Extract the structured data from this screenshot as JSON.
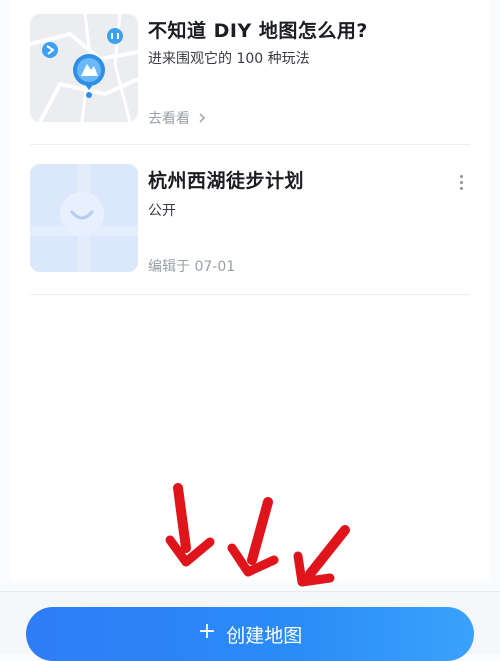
{
  "maps": [
    {
      "title": "不知道 DIY 地图怎么用?",
      "subtitle": "进来围观它的 100 种玩法",
      "meta": "去看看",
      "meta_icon": "chevron-right-icon",
      "thumb_icon": "map-pins-icon"
    },
    {
      "title": "杭州西湖徒步计划",
      "subtitle": "公开",
      "meta": "编辑于 07-01",
      "thumb_icon": "smile-location-icon"
    }
  ],
  "more_icon": "more-vertical-icon",
  "create_button": {
    "icon": "plus-icon",
    "label": "创建地图"
  },
  "annotation": {
    "arrows": 3,
    "color": "#e0141b"
  },
  "colors": {
    "accent": "#2f80f6",
    "thumb_bg_2": "#dbe7fb"
  }
}
